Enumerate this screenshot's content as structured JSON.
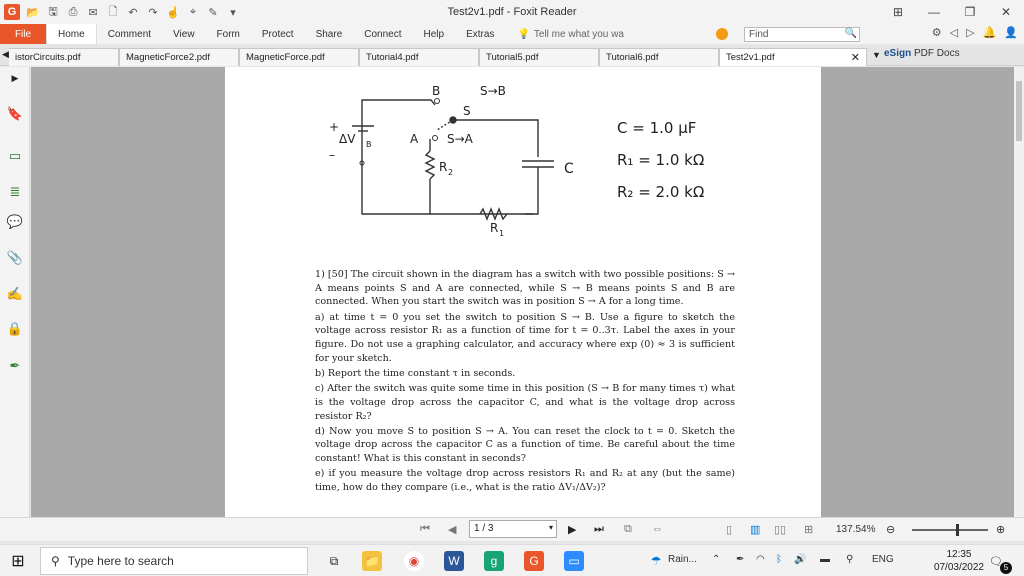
{
  "window": {
    "title": "Test2v1.pdf - Foxit Reader"
  },
  "menu": {
    "file": "File",
    "items": [
      "Home",
      "Comment",
      "View",
      "Form",
      "Protect",
      "Share",
      "Connect",
      "Help",
      "Extras"
    ],
    "tell_me": "Tell me what you wа",
    "find_placeholder": "Find"
  },
  "tabs": [
    {
      "label": "istorCircuits.pdf"
    },
    {
      "label": "MagneticForce2.pdf"
    },
    {
      "label": "MagneticForce.pdf"
    },
    {
      "label": "Tutorial4.pdf"
    },
    {
      "label": "Tutorial5.pdf"
    },
    {
      "label": "Tutorial6.pdf"
    },
    {
      "label": "Test2v1.pdf"
    }
  ],
  "esign": {
    "brand": "eSign",
    "label": "PDF Docs"
  },
  "diagram": {
    "B": "B",
    "S_to_B": "S→B",
    "S": "S",
    "A": "A",
    "S_to_A": "S→A",
    "plus": "+",
    "minus": "–",
    "dVB": "ΔV",
    "dVB_sub": "B",
    "R2": "R",
    "R2_sub": "2",
    "C": "C",
    "R1": "R",
    "R1_sub": "1",
    "eq_C": "C = 1.0 μF",
    "eq_R1": "R₁ = 1.0 kΩ",
    "eq_R2": "R₂ = 2.0 kΩ"
  },
  "problem": {
    "intro": "1) [50] The circuit shown in the diagram has a switch with two possible positions: S → A means points S and A are connected, while S → B means points S and B are connected. When you start the switch was in position S → A for a long time.",
    "a": "a) at time t = 0 you set the switch to position S → B. Use a figure to sketch the voltage across resistor R₁ as a function of time for t = 0..3τ. Label the axes in your figure. Do not use a graphing calculator, and accuracy where exp (0) ≈ 3 is sufficient for your sketch.",
    "b": "b) Report the time constant τ in seconds.",
    "c": "c) After the switch was quite some time in this position (S → B for many times τ) what is the voltage drop across the capacitor C, and what is the voltage drop across resistor R₂?",
    "d": "d) Now you move S to position S → A. You can reset the clock to t = 0. Sketch the voltage drop across the capacitor C as a function of time. Be careful about the time constant! What is this constant in seconds?",
    "e": "e) if you measure the voltage drop across resistors R₁ and R₂ at any (but the same) time, how do they compare (i.e., what is the ratio ΔV₁/ΔV₂)?"
  },
  "nav": {
    "page": "1 / 3",
    "zoom": "137.54%"
  },
  "taskbar": {
    "search_placeholder": "Type here to search",
    "weather": "Rain...",
    "lang": "ENG",
    "time": "12:35",
    "date": "07/03/2022",
    "notif": "5"
  },
  "colors": {
    "accent": "#e8562a",
    "win_blue": "#0078d7"
  }
}
